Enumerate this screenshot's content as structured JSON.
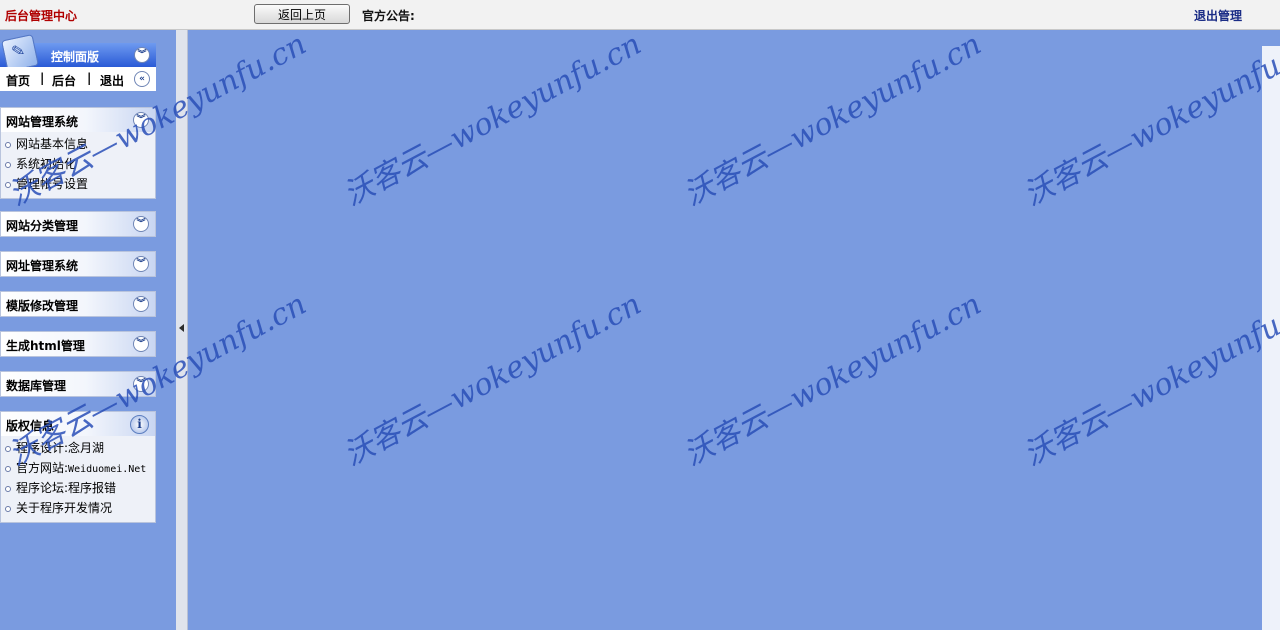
{
  "header": {
    "brand": "后台管理中心",
    "back_button": "返回上页",
    "notice_label": "官方公告:",
    "logout": "退出管理"
  },
  "sidebar": {
    "panel_title": "控制面版",
    "collapse_icon": "double-chevron-down-icon",
    "nav": {
      "home": "首页",
      "backend": "后台",
      "exit": "退出",
      "sep": "|"
    },
    "sections": [
      {
        "title": "网站管理系统",
        "items": [
          "网站基本信息",
          "系统初始化",
          "管理帐号设置"
        ]
      },
      {
        "title": "网站分类管理",
        "items": []
      },
      {
        "title": "网址管理系统",
        "items": []
      },
      {
        "title": "模版修改管理",
        "items": []
      },
      {
        "title": "生成html管理",
        "items": []
      },
      {
        "title": "数据库管理",
        "items": []
      }
    ],
    "copyright": {
      "title": "版权信息",
      "items": [
        "程序设计:念月湖",
        "官方网站:",
        "程序论坛:程序报错",
        "关于程序开发情况"
      ],
      "site": "Weiduomei.Net"
    }
  },
  "watermark": "沃客云—wokeyunfu.cn"
}
